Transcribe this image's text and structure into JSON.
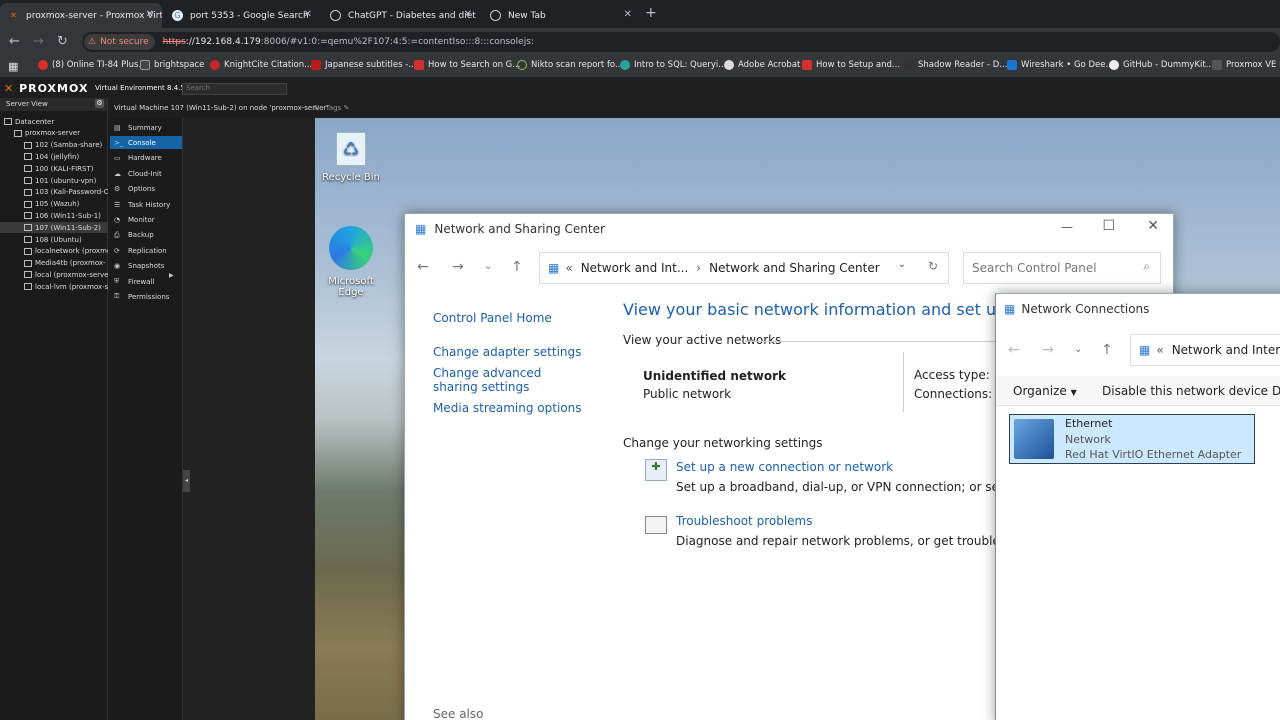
{
  "browser": {
    "tabs": [
      {
        "title": "proxmox-server - Proxmox Virtu",
        "active": true
      },
      {
        "title": "port 5353 - Google Search",
        "active": false
      },
      {
        "title": "ChatGPT - Diabetes and diet",
        "active": false
      },
      {
        "title": "New Tab",
        "active": false
      }
    ],
    "not_secure": "Not secure",
    "url_https": "https",
    "url_host": "://192.168.4.179",
    "url_rest": ":8006/#v1:0:=qemu%2F107:4:5:=contentIso:::8:::consolejs:",
    "bookmarks": [
      "(8) Online TI-84 Plus...",
      "brightspace",
      "KnightCite Citation...",
      "Japanese subtitles -...",
      "How to Search on G...",
      "Nikto scan report fo...",
      "Intro to SQL: Queryi...",
      "Adobe Acrobat",
      "How to Setup and...",
      "Shadow Reader - D...",
      "Wireshark • Go Dee...",
      "GitHub - DummyKit...",
      "Proxmox VE He"
    ]
  },
  "proxmox": {
    "logo": "PROXMOX",
    "version": "Virtual Environment 8.4.5",
    "search_placeholder": "Search",
    "server_view": "Server View",
    "tree": [
      {
        "label": "Datacenter",
        "indent": 0
      },
      {
        "label": "proxmox-server",
        "indent": 1
      },
      {
        "label": "102 (Samba-share)",
        "indent": 2
      },
      {
        "label": "104 (jellyfin)",
        "indent": 2
      },
      {
        "label": "100 (KALI-FIRST)",
        "indent": 2
      },
      {
        "label": "101 (ubuntu-vpn)",
        "indent": 2
      },
      {
        "label": "103 (Kali-Password-C",
        "indent": 2
      },
      {
        "label": "105 (Wazuh)",
        "indent": 2
      },
      {
        "label": "106 (Win11-Sub-1)",
        "indent": 2
      },
      {
        "label": "107 (Win11-Sub-2)",
        "indent": 2,
        "selected": true
      },
      {
        "label": "108 (Ubuntu)",
        "indent": 2
      },
      {
        "label": "localnetwork (proxmc",
        "indent": 2
      },
      {
        "label": "Media4tb (proxmox-",
        "indent": 2
      },
      {
        "label": "local (proxmox-serve",
        "indent": 2
      },
      {
        "label": "local-lvm (proxmox-s",
        "indent": 2
      }
    ],
    "vm_title": "Virtual Machine 107 (Win11-Sub-2) on node 'proxmox-server'",
    "no_tags": "No Tags",
    "menu": [
      "Summary",
      "Console",
      "Hardware",
      "Cloud-Init",
      "Options",
      "Task History",
      "Monitor",
      "Backup",
      "Replication",
      "Snapshots",
      "Firewall",
      "Permissions"
    ],
    "menu_selected": "Console"
  },
  "desktop": {
    "icons": [
      {
        "label": "Recycle Bin"
      },
      {
        "label": "Microsoft Edge"
      }
    ]
  },
  "nsc": {
    "title": "Network and Sharing Center",
    "crumb1": "Network and Int...",
    "crumb2": "Network and Sharing Center",
    "search_placeholder": "Search Control Panel",
    "left_links": [
      "Control Panel Home",
      "Change adapter settings",
      "Change advanced sharing settings",
      "Media streaming options"
    ],
    "see_also": "See also",
    "heading": "View your basic network information and set up conne",
    "active_networks": "View your active networks",
    "network_name": "Unidentified network",
    "network_type": "Public network",
    "access_type": "Access type:",
    "connections": "Connections:",
    "change_settings": "Change your networking settings",
    "setup_link": "Set up a new connection or network",
    "setup_desc": "Set up a broadband, dial-up, or VPN connection; or set up a ro",
    "trouble_link": "Troubleshoot problems",
    "trouble_desc": "Diagnose and repair network problems, or get troubleshooting"
  },
  "netconn": {
    "title": "Network Connections",
    "crumb": "Network and Interne",
    "organize": "Organize",
    "disable": "Disable this network device",
    "more": "D",
    "adapter_name": "Ethernet",
    "adapter_status": "Network",
    "adapter_device": "Red Hat VirtIO Ethernet Adapter"
  }
}
